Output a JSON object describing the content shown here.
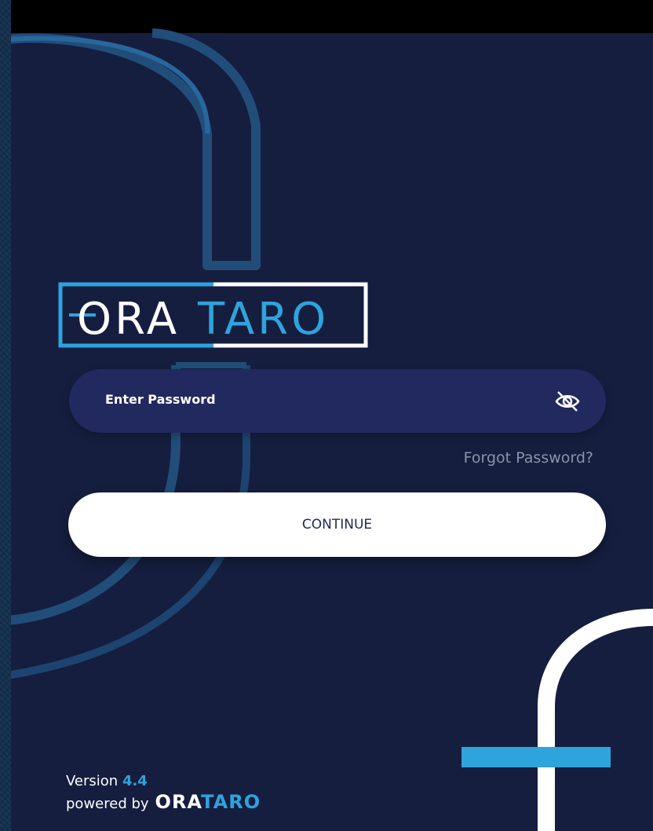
{
  "brand": {
    "logo_left": "ORA",
    "logo_right": "TARO",
    "accent_color": "#2fa3dc",
    "background_color": "#151e3f"
  },
  "login": {
    "password_placeholder": "Enter Password",
    "visibility_icon": "eye-off-icon",
    "forgot_label": "Forgot Password?",
    "continue_label": "CONTINUE"
  },
  "footer": {
    "version_label": "Version",
    "version_number": "4.4",
    "powered_by_label": "powered by",
    "brand_left": "ORA",
    "brand_right": "TARO"
  }
}
